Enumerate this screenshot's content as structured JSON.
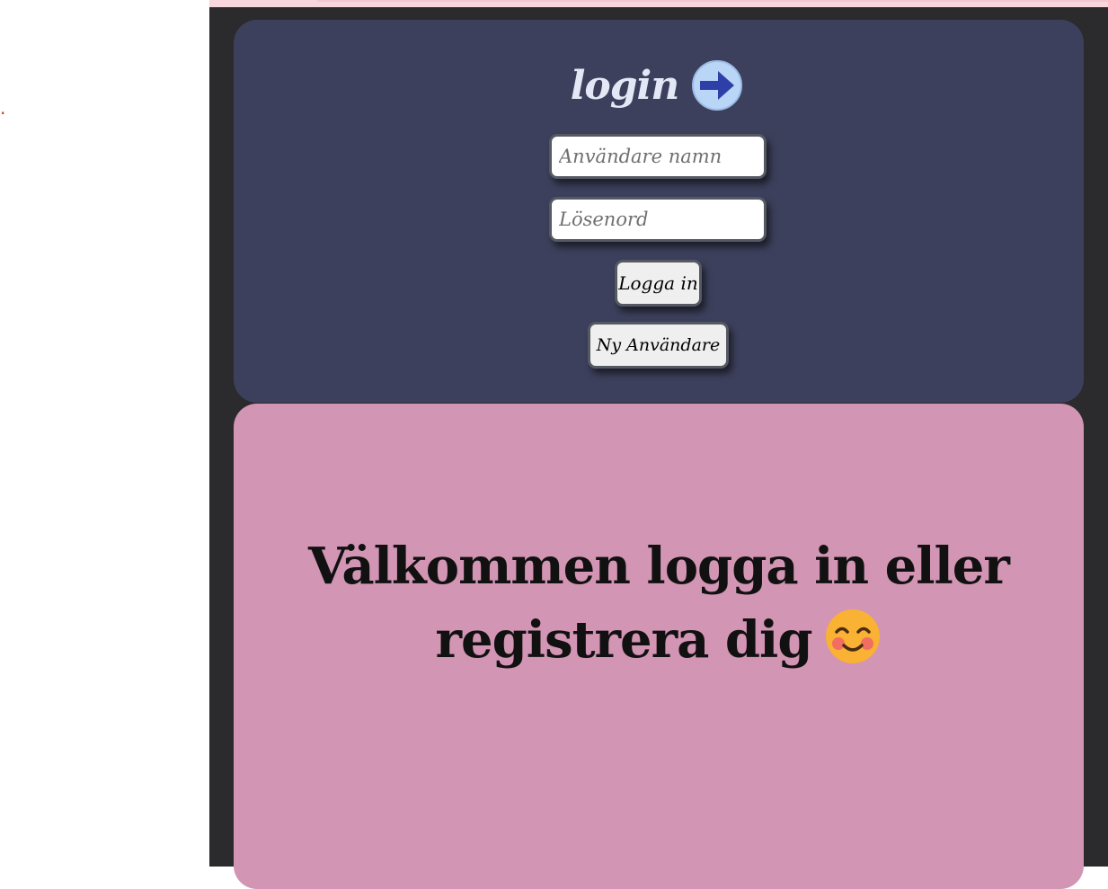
{
  "stray_mark": ".",
  "login": {
    "title": "login",
    "username_placeholder": "Användare namn",
    "password_placeholder": "Lösenord",
    "login_button": "Logga in",
    "new_user_button": "Ny Användare",
    "icon": "arrow-right-circle-icon"
  },
  "welcome": {
    "text": "Välkommen logga in eller registrera dig",
    "icon": "smiling-face-icon"
  },
  "colors": {
    "frame": "#2b2b2d",
    "login_panel": "#3d405c",
    "welcome_panel": "#d295b3",
    "top_strip": "#f9d6dc"
  }
}
